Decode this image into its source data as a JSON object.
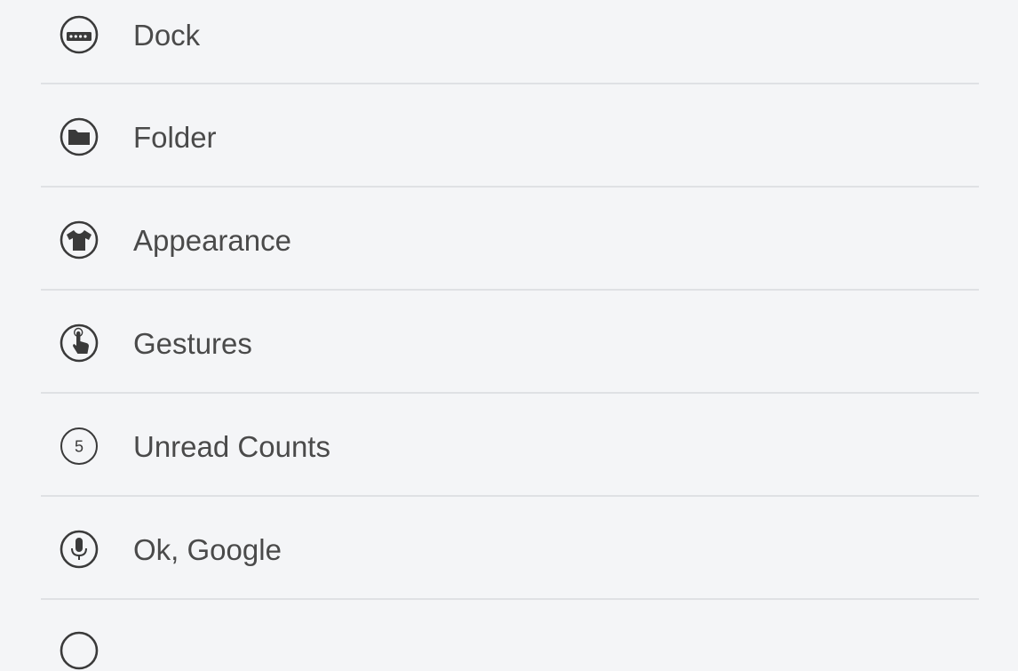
{
  "settings": {
    "items": [
      {
        "label": "Dock",
        "icon": "dock-icon"
      },
      {
        "label": "Folder",
        "icon": "folder-icon"
      },
      {
        "label": "Appearance",
        "icon": "shirt-icon"
      },
      {
        "label": "Gestures",
        "icon": "touch-gesture-icon"
      },
      {
        "label": "Unread Counts",
        "icon": "unread-count-icon",
        "icon_text": "5"
      },
      {
        "label": "Ok, Google",
        "icon": "microphone-icon"
      }
    ]
  },
  "colors": {
    "background": "#f4f5f7",
    "divider": "#dfe1e4",
    "icon": "#3a3a3a",
    "text": "#4a4a4a"
  }
}
